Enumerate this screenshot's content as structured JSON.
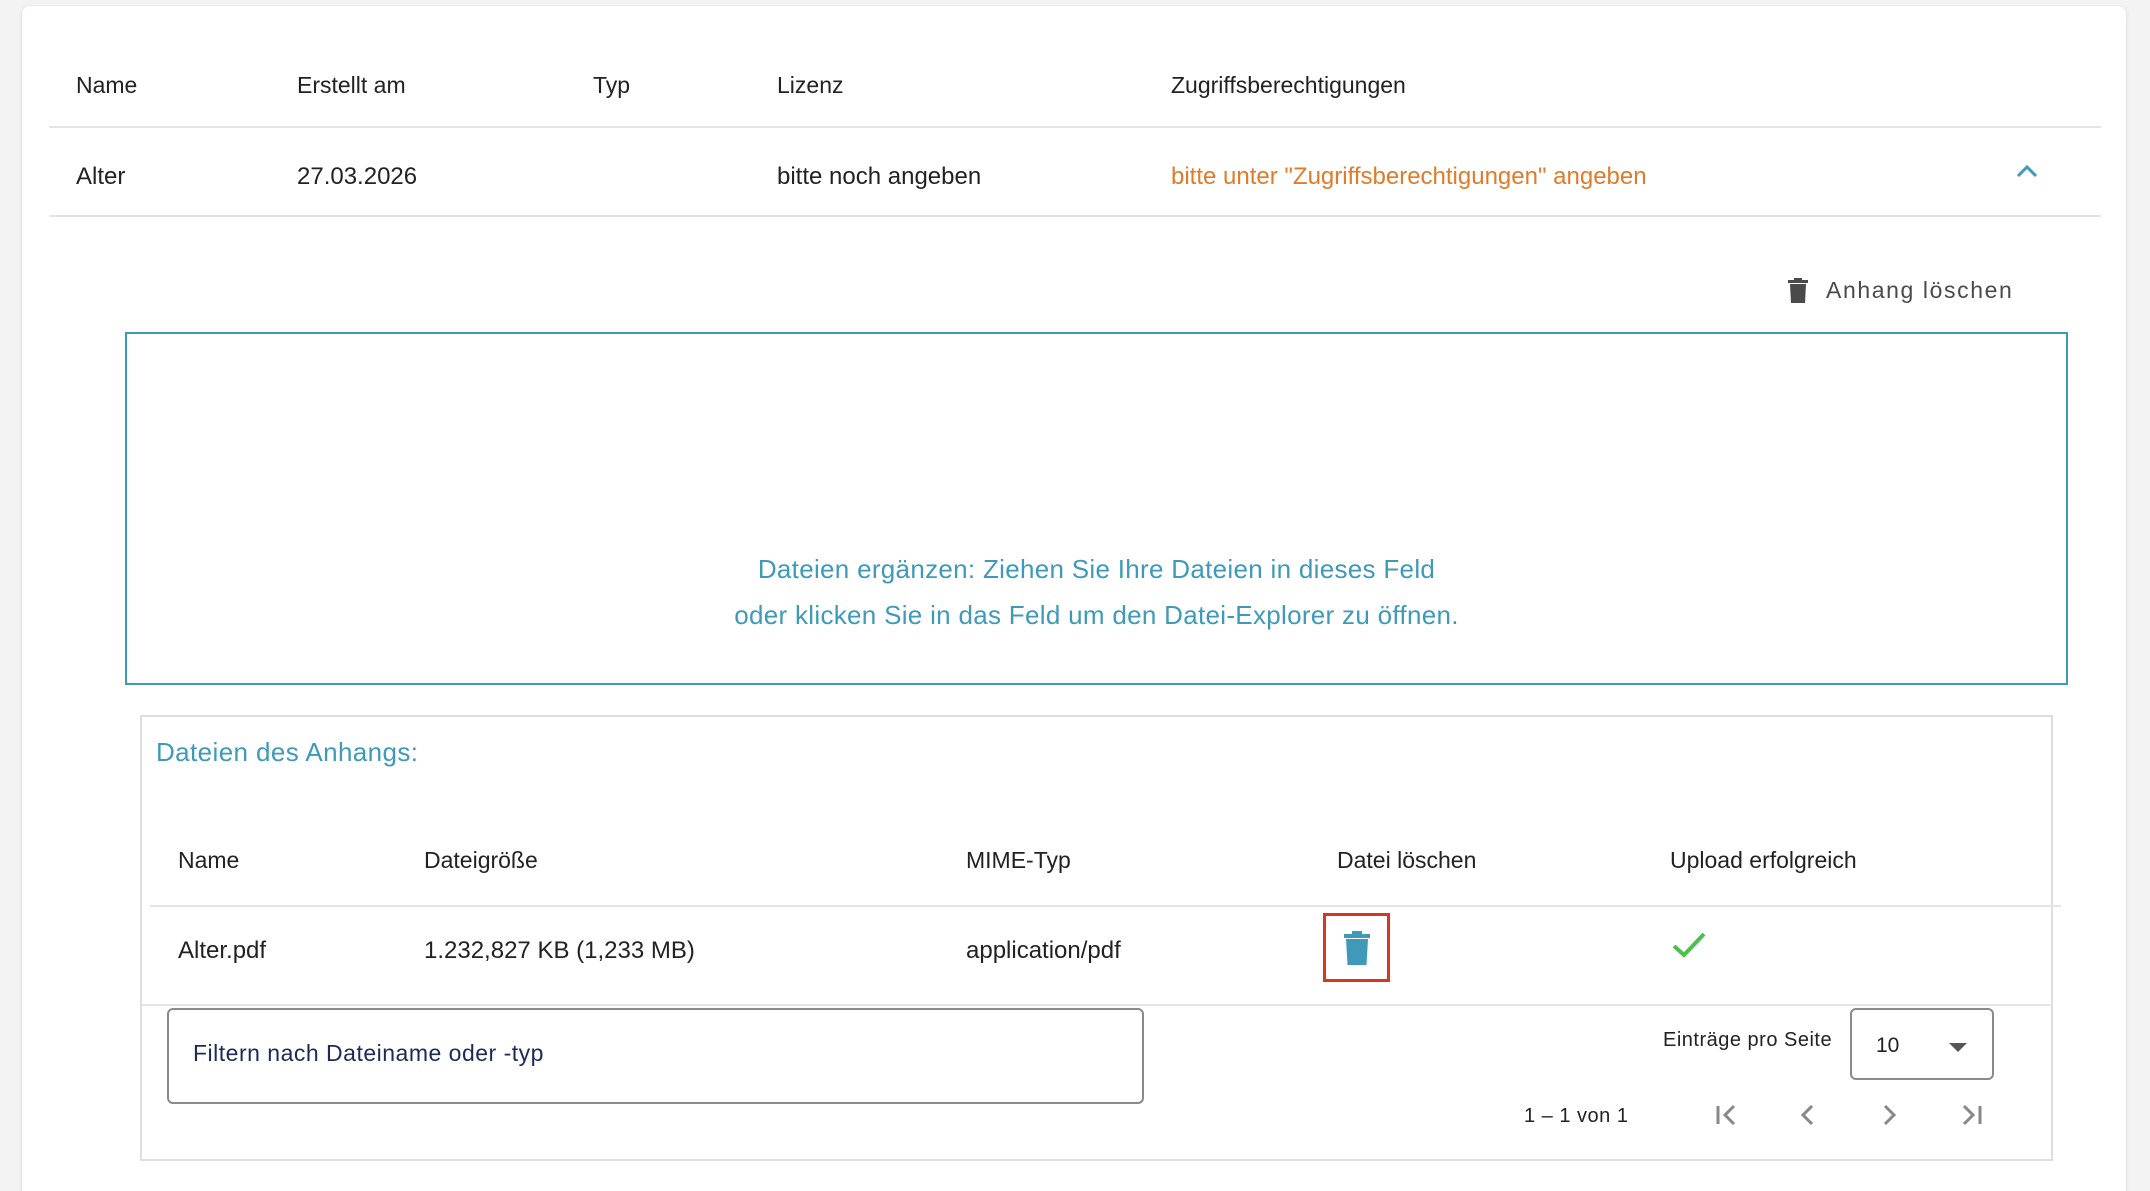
{
  "table": {
    "headers": [
      "Name",
      "Erstellt am",
      "Typ",
      "Lizenz",
      "Zugriffsberechtigungen"
    ],
    "row": {
      "name": "Alter",
      "created": "27.03.2026",
      "type": "",
      "license": "bitte noch angeben",
      "permissions": "bitte unter \"Zugriffsberechtigungen\" angeben"
    }
  },
  "attachment": {
    "delete_label": "Anhang löschen",
    "dropzone_line1": "Dateien ergänzen: Ziehen Sie Ihre Dateien in dieses Feld",
    "dropzone_line2": "oder klicken Sie in das Feld um den Datei-Explorer zu öffnen."
  },
  "files": {
    "title": "Dateien des Anhangs:",
    "headers": [
      "Name",
      "Dateigröße",
      "MIME-Typ",
      "Datei löschen",
      "Upload erfolgreich"
    ],
    "rows": [
      {
        "name": "Alter.pdf",
        "size": "1.232,827 KB (1,233 MB)",
        "mime": "application/pdf",
        "upload_success": true
      }
    ],
    "filter_placeholder": "Filtern nach Dateiname oder -typ",
    "entries_per_page_label": "Einträge pro Seite",
    "entries_per_page_value": "10",
    "range_text": "1 – 1 von 1"
  },
  "colors": {
    "accent": "#3e9ab8",
    "warning": "#e07b2a",
    "highlight": "#d9361f",
    "success": "#4cbf4c"
  },
  "icons": [
    "trash-icon",
    "chevron-up-icon",
    "check-icon",
    "dropdown-arrow-icon",
    "first-page-icon",
    "prev-page-icon",
    "next-page-icon",
    "last-page-icon"
  ]
}
